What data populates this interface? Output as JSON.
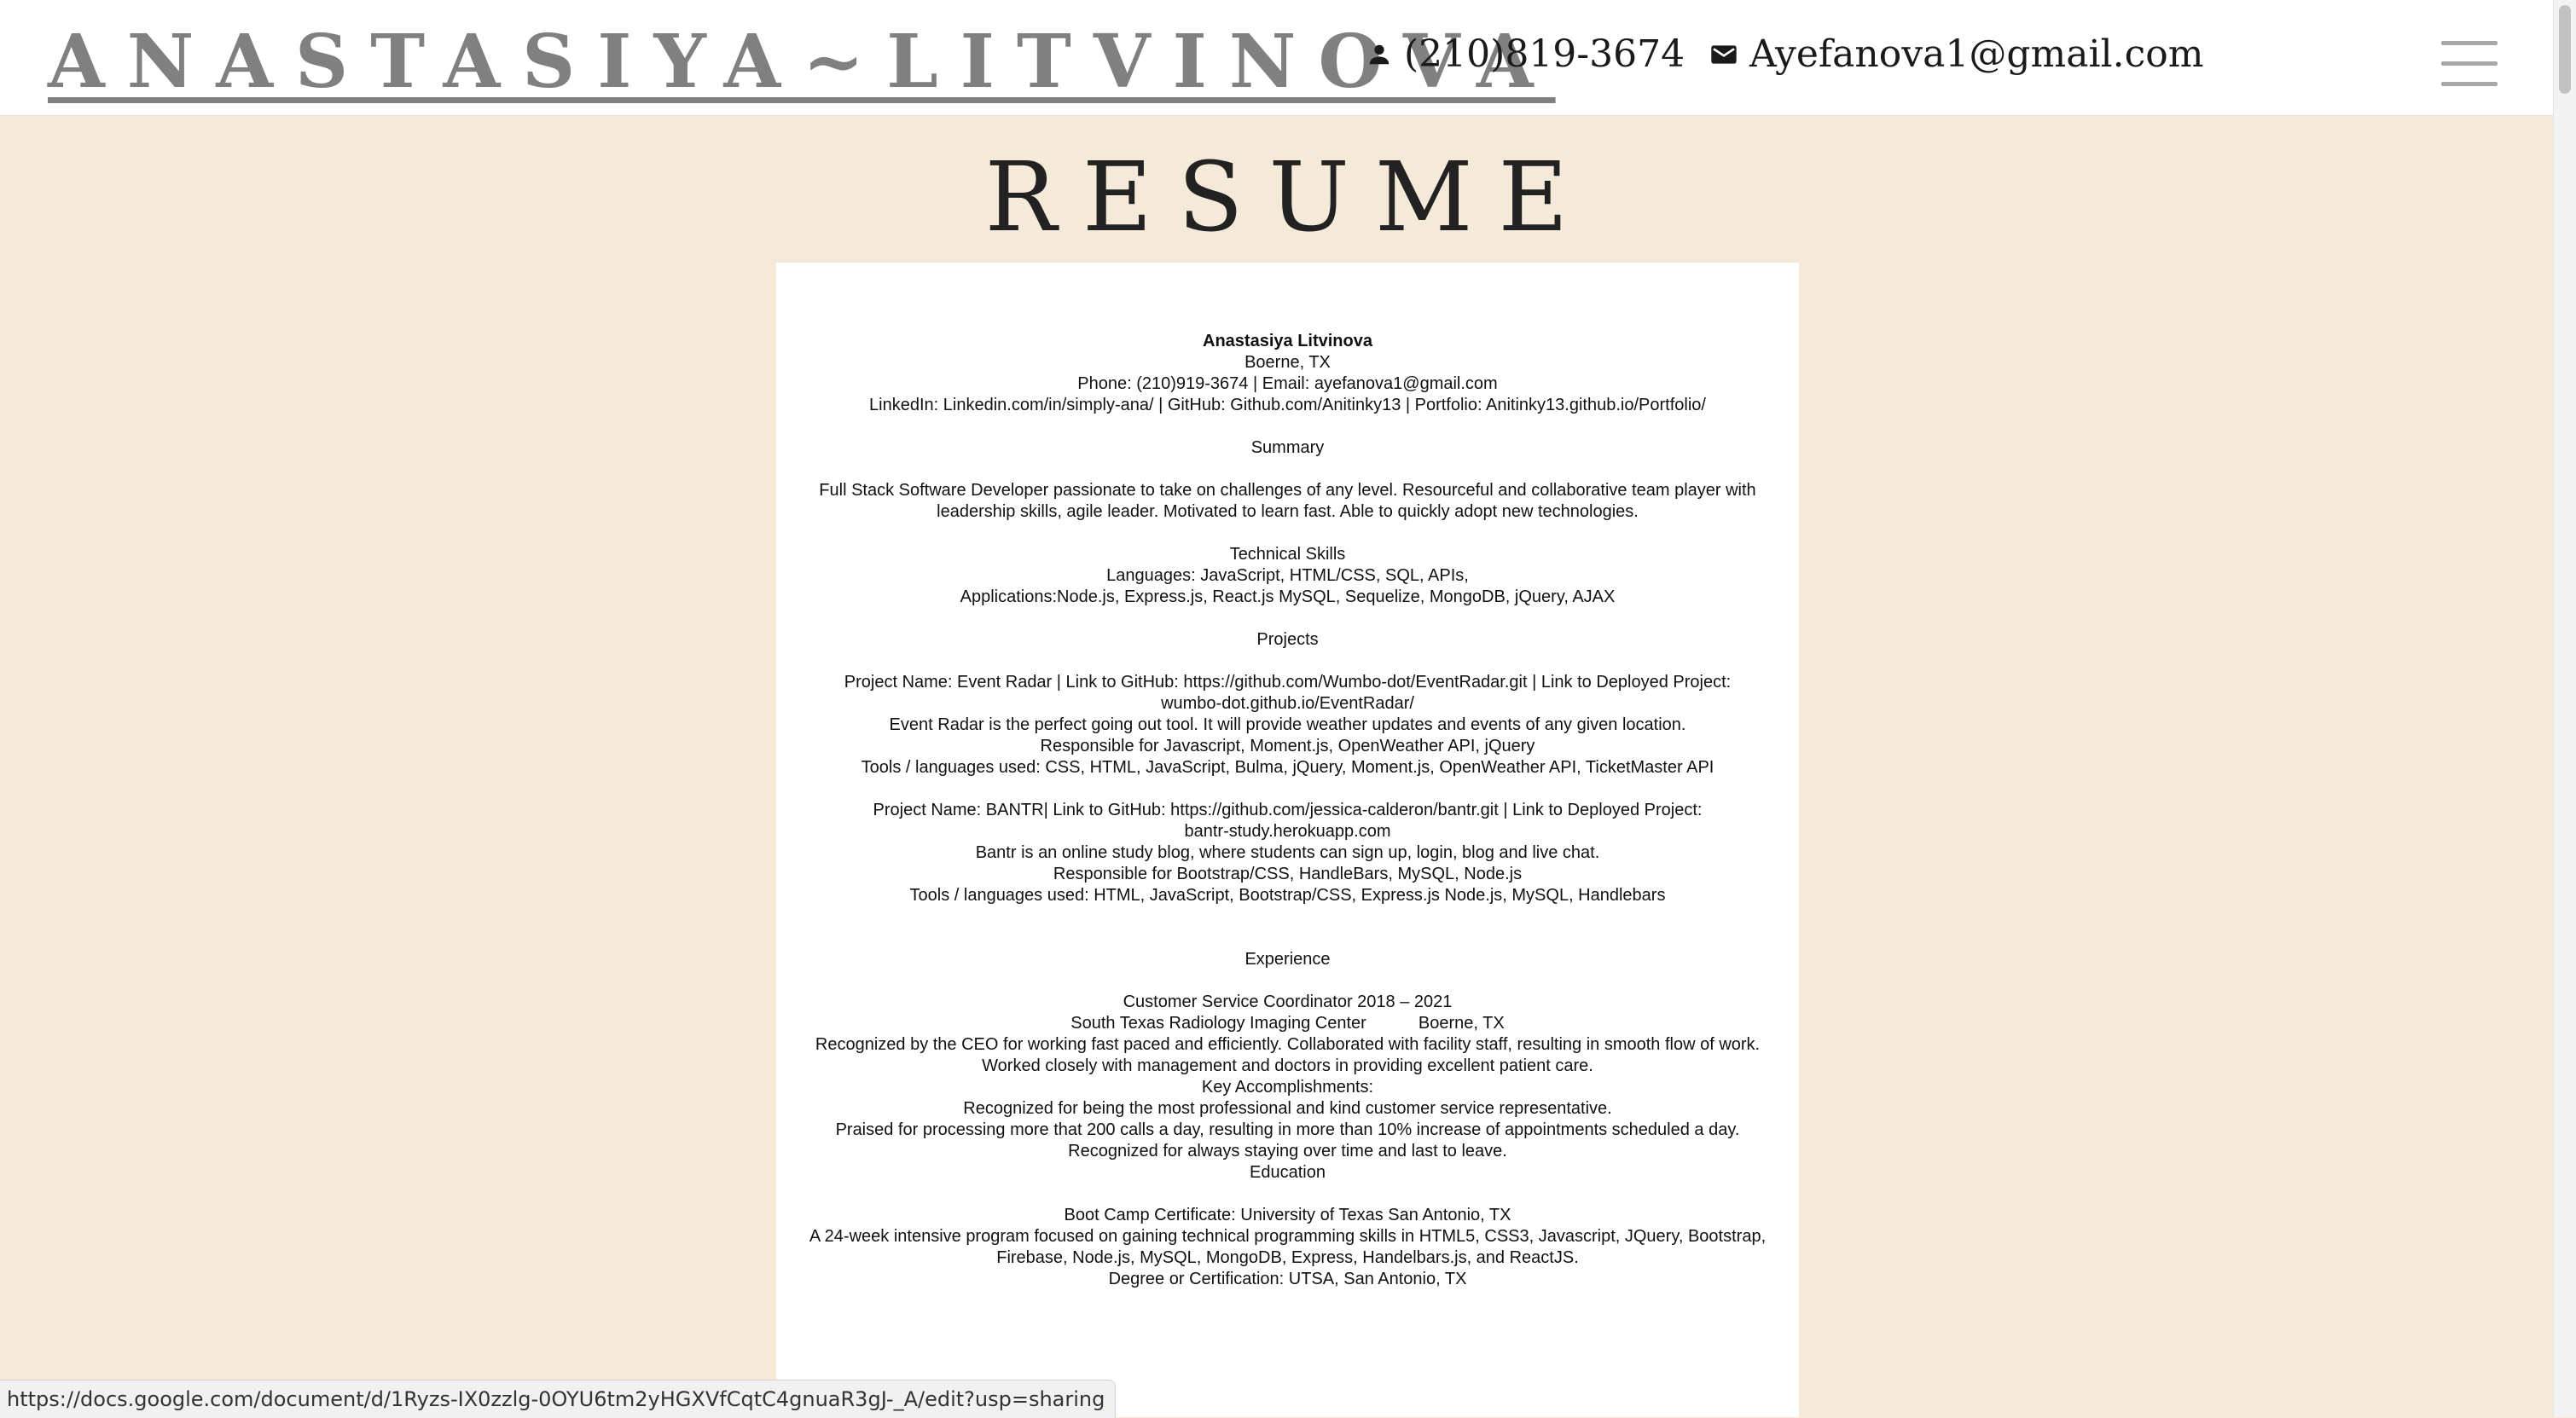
{
  "header": {
    "brand": "ANASTASIYA~LITVINOVA",
    "phone": "(210)819-3674",
    "email": "Ayefanova1@gmail.com",
    "icons": {
      "phone": "person-icon",
      "email": "mail-icon",
      "menu": "hamburger-menu-icon"
    }
  },
  "main": {
    "title": "RESUME"
  },
  "resume": {
    "name": "Anastasiya Litvinova",
    "location": "Boerne, TX",
    "contact_line": "Phone: (210)919-3674 | Email: ayefanova1@gmail.com",
    "links_line": "LinkedIn: Linkedin.com/in/simply-ana/ | GitHub: Github.com/Anitinky13 | Portfolio: Anitinky13.github.io/Portfolio/",
    "summary_heading": "Summary",
    "summary_text": "Full Stack Software Developer passionate to take on challenges of any level. Resourceful and collaborative team player with leadership skills, agile leader. Motivated to learn fast. Able to quickly adopt new technologies.",
    "skills_heading": "Technical Skills",
    "skills_languages": "Languages: JavaScript, HTML/CSS, SQL, APIs,",
    "skills_applications": "Applications:Node.js, Express.js, React.js MySQL, Sequelize, MongoDB, jQuery, AJAX",
    "projects_heading": "Projects",
    "project1_title": "Project Name: Event Radar | Link to GitHub: https://github.com/Wumbo-dot/EventRadar.git | Link to Deployed Project:",
    "project1_url": "wumbo-dot.github.io/EventRadar/",
    "project1_desc": "Event Radar is the perfect going out tool. It will provide weather updates and events of any given location.",
    "project1_resp": "Responsible for Javascript, Moment.js, OpenWeather API, jQuery",
    "project1_tools": "Tools / languages used: CSS, HTML, JavaScript, Bulma, jQuery, Moment.js, OpenWeather API, TicketMaster API",
    "project2_title": "Project Name: BANTR| Link to GitHub: https://github.com/jessica-calderon/bantr.git  | Link to Deployed Project:",
    "project2_url": "bantr-study.herokuapp.com",
    "project2_desc": "Bantr is an online study blog, where students can sign up, login, blog and live chat.",
    "project2_resp": "Responsible for Bootstrap/CSS, HandleBars, MySQL, Node.js",
    "project2_tools": "Tools / languages used: HTML, JavaScript, Bootstrap/CSS, Express.js Node.js, MySQL, Handlebars",
    "experience_heading": "Experience",
    "job_title": "Customer Service Coordinator  2018 – 2021",
    "job_company": "South Texas Radiology Imaging Center           Boerne, TX",
    "job_desc": "Recognized by the CEO for working fast paced and efficiently. Collaborated with facility staff, resulting in smooth flow of work. Worked closely with management and doctors in providing excellent patient care.",
    "accomplishments_heading": "Key Accomplishments:",
    "accomplishment1": "Recognized for being the most professional and kind customer service representative.",
    "accomplishment2": "Praised for processing more that 200 calls a day, resulting in more than 10% increase of appointments scheduled a day.",
    "accomplishment3": "Recognized for always staying over time and last to leave.",
    "education_heading": "Education",
    "edu_cert": "Boot Camp Certificate: University of Texas San Antonio, TX",
    "edu_desc": "A 24-week intensive program focused on gaining technical programming skills in HTML5, CSS3, Javascript, JQuery, Bootstrap, Firebase, Node.js, MySQL, MongoDB, Express, Handelbars.js, and ReactJS.",
    "edu_degree": "Degree or Certification: UTSA, San Antonio, TX"
  },
  "status_bar": {
    "url": "https://docs.google.com/document/d/1Ryzs-IX0zzlg-0OYU6tm2yHGXVfCqtC4gnuaR3gJ-_A/edit?usp=sharing"
  },
  "colors": {
    "page_background": "#f5eada",
    "header_background": "#ffffff",
    "brand_text": "#808080",
    "hamburger": "#a8a8a8"
  }
}
